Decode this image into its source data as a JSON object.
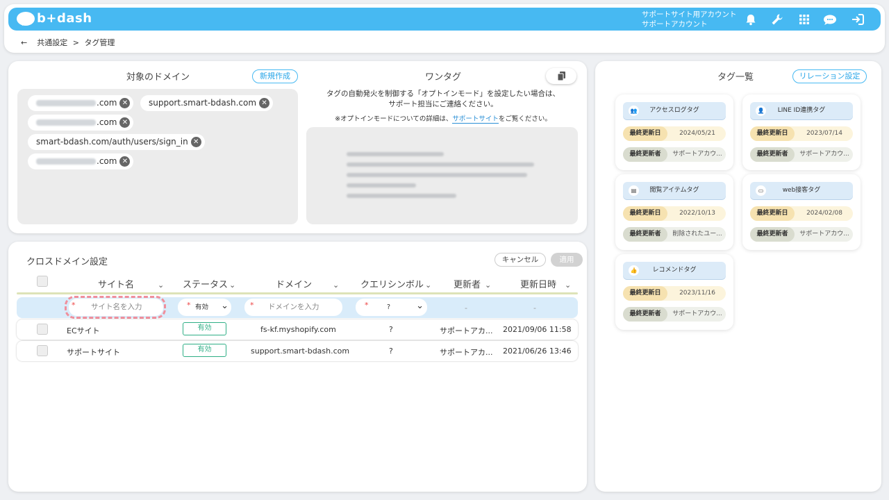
{
  "header": {
    "logo_text": "b+dash",
    "account_line1": "サポートサイト用アカウント",
    "account_line2": "サポートアカウント",
    "icons": [
      "bell-icon",
      "wrench-icon",
      "grid-icon",
      "chat-icon",
      "logout-icon"
    ],
    "accent": "#47b9f2"
  },
  "breadcrumb": {
    "back": "←",
    "parent": "共通設定",
    "separator": ">",
    "current": "タグ管理"
  },
  "domains": {
    "title": "対象のドメイン",
    "new_button": "新規作成",
    "items": [
      {
        "suffix": ".com"
      },
      {
        "text": "support.smart-bdash.com"
      },
      {
        "suffix": ".com"
      },
      {
        "text": "smart-bdash.com/auth/users/sign_in"
      },
      {
        "suffix": ".com"
      }
    ]
  },
  "one_tag": {
    "title": "ワンタグ",
    "copy_icon": "copy-icon",
    "notice_line1": "タグの自動発火を制御する「オプトインモード」を設定したい場合は、",
    "notice_line2": "サポート担当にご連絡ください。",
    "detail_prefix": "※オプトインモードについての詳細は、",
    "detail_link": "サポートサイト",
    "detail_suffix": "をご覧ください。"
  },
  "cross_domain": {
    "title": "クロスドメイン設定",
    "cancel_button": "キャンセル",
    "apply_button": "適用",
    "columns": [
      "サイト名",
      "ステータス",
      "ドメイン",
      "クエリシンボル",
      "更新者",
      "更新日時"
    ],
    "new_row": {
      "site_placeholder": "サイト名を入力",
      "required_mark": "*",
      "status_value": "有効",
      "domain_placeholder": "ドメインを入力",
      "query_value": "?",
      "updater": "-",
      "updated_at": "-"
    },
    "rows": [
      {
        "site": "ECサイト",
        "status": "有効",
        "domain": "fs-kf.myshopify.com",
        "query": "?",
        "updater": "サポートアカ...",
        "updated_at": "2021/09/06 11:58"
      },
      {
        "site": "サポートサイト",
        "status": "有効",
        "domain": "support.smart-bdash.com",
        "query": "?",
        "updater": "サポートアカ...",
        "updated_at": "2021/06/26 13:46"
      }
    ]
  },
  "tag_list": {
    "title": "タグ一覧",
    "relation_button": "リレーション設定",
    "last_updated_label": "最終更新日",
    "updater_label": "最終更新者",
    "tags": [
      {
        "name": "アクセスログタグ",
        "icon": "users-icon",
        "icon_glyph": "👥",
        "date": "2024/05/21",
        "updater": "サポートアカウ..."
      },
      {
        "name": "LINE ID連携タグ",
        "icon": "person-icon",
        "icon_glyph": "👤",
        "date": "2023/07/14",
        "updater": "サポートアカウ..."
      },
      {
        "name": "閲覧アイテムタグ",
        "icon": "list-icon",
        "icon_glyph": "▤",
        "date": "2022/10/13",
        "updater": "削除されたユー..."
      },
      {
        "name": "web接客タグ",
        "icon": "monitor-icon",
        "icon_glyph": "▭",
        "date": "2024/02/08",
        "updater": "サポートアカウ..."
      },
      {
        "name": "レコメンドタグ",
        "icon": "thumbs-up-icon",
        "icon_glyph": "👍",
        "date": "2023/11/16",
        "updater": "サポートアカウ..."
      }
    ]
  }
}
